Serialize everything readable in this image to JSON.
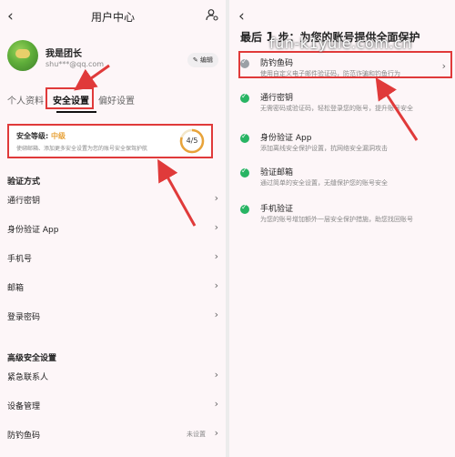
{
  "left": {
    "title": "用户中心",
    "profile": {
      "name": "我是团长",
      "email": "shu***@qq.com",
      "edit_label": "编辑"
    },
    "tabs": [
      {
        "label": "个人资料"
      },
      {
        "label": "安全设置"
      },
      {
        "label": "偏好设置"
      }
    ],
    "security_card": {
      "label": "安全等级:",
      "level": "中级",
      "description": "使绑邮箱、添加更多安全设置为您的账号安全保驾护航",
      "progress_text": "4/5",
      "progress_fraction": 0.8
    },
    "verify_section": {
      "title": "验证方式",
      "items": [
        {
          "label": "通行密钥"
        },
        {
          "label": "身份验证 App"
        },
        {
          "label": "手机号"
        },
        {
          "label": "邮箱"
        },
        {
          "label": "登录密码"
        }
      ]
    },
    "advanced_section": {
      "title": "高级安全设置",
      "items": [
        {
          "label": "紧急联系人",
          "value": ""
        },
        {
          "label": "设备管理",
          "value": ""
        },
        {
          "label": "防钓鱼码",
          "value": "未设置"
        }
      ]
    }
  },
  "right": {
    "heading_prefix": "最后",
    "heading_number": "1",
    "heading_suffix": "步：为您的账号提供全面保护",
    "watermark": "fun-k1yule.com.cn",
    "items": [
      {
        "title": "防钓鱼码",
        "desc": "使用自定义电子邮件验证码，防范诈骗和钓鱼行为"
      },
      {
        "title": "通行密钥",
        "desc": "无需密码或验证码，轻松登录您的账号，提升账号安全"
      },
      {
        "title": "身份验证 App",
        "desc": "添加离线安全保护设置，抗网络安全漏洞攻击"
      },
      {
        "title": "验证邮箱",
        "desc": "通过简单的安全设置，无缝保护您的账号安全"
      },
      {
        "title": "手机验证",
        "desc": "为您的账号增加额外一层安全保护措施，助您找回账号"
      }
    ]
  },
  "colors": {
    "accent_red": "#e03a3a",
    "success_green": "#28b463",
    "level_orange": "#e8a33a",
    "background": "#fdf6f8"
  },
  "icons": [
    "back-icon",
    "user-settings-icon",
    "edit-icon",
    "chevron-right-icon",
    "check-circle-icon"
  ]
}
